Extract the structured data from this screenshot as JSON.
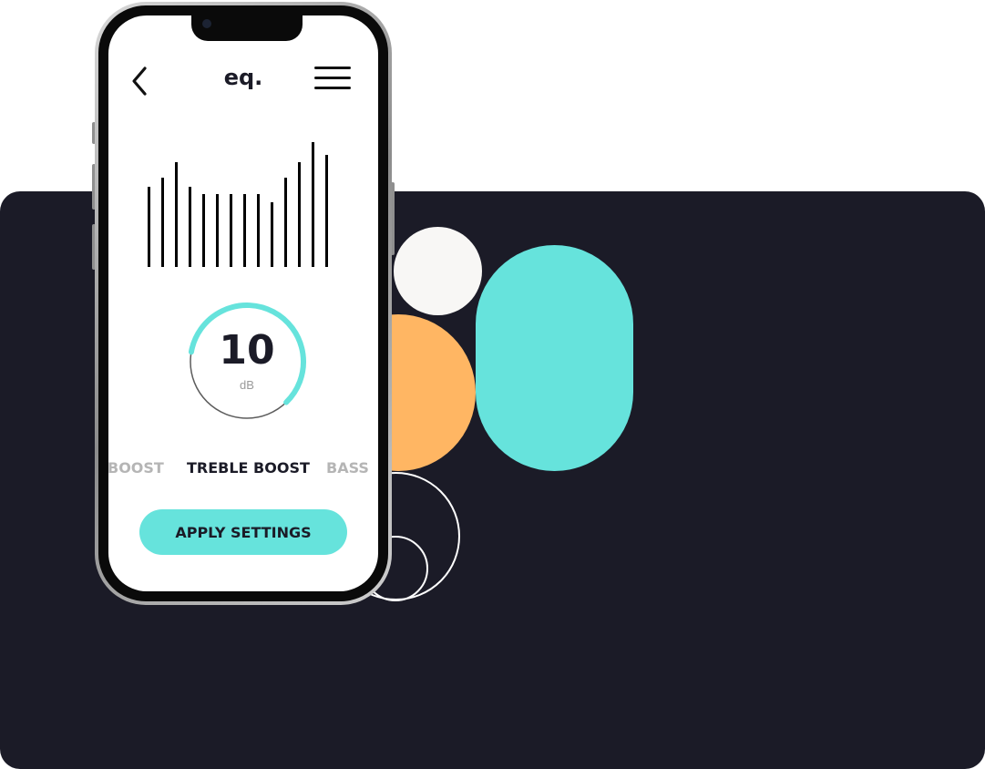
{
  "colors": {
    "background": "#ffffff",
    "panel": "#1b1b27",
    "accent_teal": "#66e3dc",
    "accent_orange": "#ffb663",
    "off_white": "#f8f7f5",
    "text_dark": "#1b1b27"
  },
  "app": {
    "title": "eq.",
    "back_icon": "chevron-left-icon",
    "menu_icon": "hamburger-menu-icon"
  },
  "equalizer": {
    "levels": [
      0.63,
      0.7,
      0.82,
      0.63,
      0.57,
      0.57,
      0.57,
      0.57,
      0.57,
      0.51,
      0.7,
      0.82,
      0.98,
      0.88
    ]
  },
  "gain": {
    "value": "10",
    "unit": "dB",
    "fill_fraction": 0.6
  },
  "presets": {
    "previous": "BOOST",
    "active": "TREBLE BOOST",
    "next": "BASS"
  },
  "actions": {
    "apply_label": "APPLY SETTINGS"
  }
}
